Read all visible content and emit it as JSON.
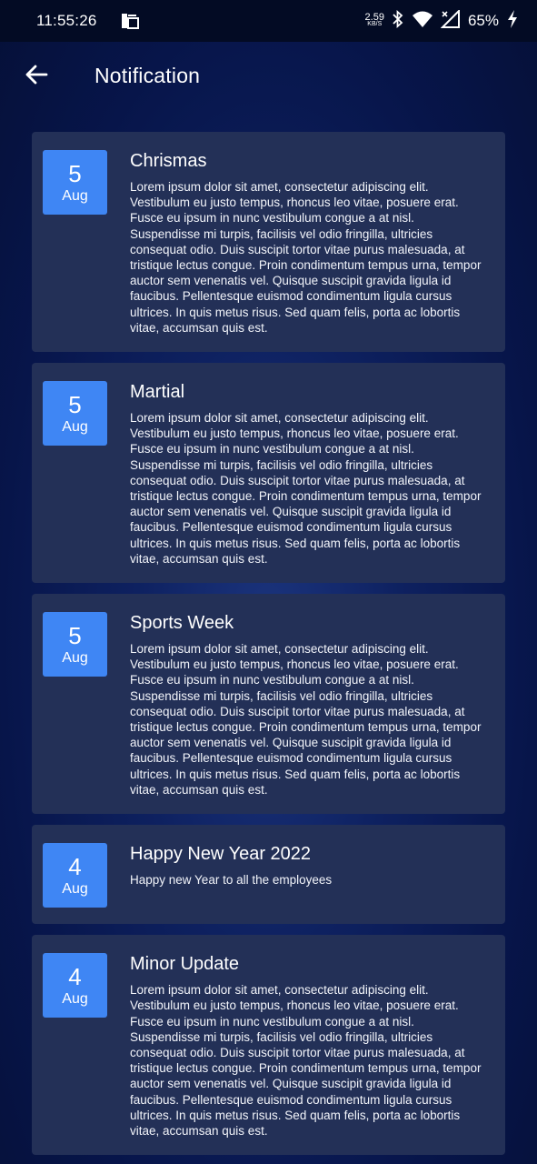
{
  "status_bar": {
    "time": "11:55:26",
    "net_speed_value": "2.59",
    "net_speed_unit": "KB/S",
    "battery": "65%",
    "icons": [
      "notification-app-icon",
      "bluetooth-icon",
      "wifi-icon",
      "signal-icon",
      "battery-charging-icon"
    ]
  },
  "header": {
    "title": "Notification",
    "back_icon": "arrow-left-icon"
  },
  "notifications": [
    {
      "day": "5",
      "month": "Aug",
      "title": "Chrismas",
      "body": "Lorem ipsum dolor sit amet, consectetur adipiscing elit. Vestibulum eu justo tempus, rhoncus leo vitae, posuere erat. Fusce eu ipsum in nunc vestibulum congue a at nisl. Suspendisse mi turpis, facilisis vel odio fringilla, ultricies consequat odio. Duis suscipit tortor vitae purus malesuada, at tristique lectus congue. Proin condimentum tempus urna, tempor auctor sem venenatis vel. Quisque suscipit gravida ligula id faucibus. Pellentesque euismod condimentum ligula cursus ultrices. In quis metus risus. Sed quam felis, porta ac lobortis vitae, accumsan quis est."
    },
    {
      "day": "5",
      "month": "Aug",
      "title": "Martial",
      "body": "Lorem ipsum dolor sit amet, consectetur adipiscing elit. Vestibulum eu justo tempus, rhoncus leo vitae, posuere erat. Fusce eu ipsum in nunc vestibulum congue a at nisl. Suspendisse mi turpis, facilisis vel odio fringilla, ultricies consequat odio. Duis suscipit tortor vitae purus malesuada, at tristique lectus congue. Proin condimentum tempus urna, tempor auctor sem venenatis vel. Quisque suscipit gravida ligula id faucibus. Pellentesque euismod condimentum ligula cursus ultrices. In quis metus risus. Sed quam felis, porta ac lobortis vitae, accumsan quis est."
    },
    {
      "day": "5",
      "month": "Aug",
      "title": "Sports Week",
      "body": "Lorem ipsum dolor sit amet, consectetur adipiscing elit. Vestibulum eu justo tempus, rhoncus leo vitae, posuere erat. Fusce eu ipsum in nunc vestibulum congue a at nisl. Suspendisse mi turpis, facilisis vel odio fringilla, ultricies consequat odio. Duis suscipit tortor vitae purus malesuada, at tristique lectus congue. Proin condimentum tempus urna, tempor auctor sem venenatis vel. Quisque suscipit gravida ligula id faucibus. Pellentesque euismod condimentum ligula cursus ultrices. In quis metus risus. Sed quam felis, porta ac lobortis vitae, accumsan quis est."
    },
    {
      "day": "4",
      "month": "Aug",
      "title": "Happy New Year 2022",
      "body": "Happy new Year to all the employees"
    },
    {
      "day": "4",
      "month": "Aug",
      "title": "Minor Update",
      "body": "Lorem ipsum dolor sit amet, consectetur adipiscing elit. Vestibulum eu justo tempus, rhoncus leo vitae, posuere erat. Fusce eu ipsum in nunc vestibulum congue a at nisl. Suspendisse mi turpis, facilisis vel odio fringilla, ultricies consequat odio. Duis suscipit tortor vitae purus malesuada, at tristique lectus congue. Proin condimentum tempus urna, tempor auctor sem venenatis vel. Quisque suscipit gravida ligula id faucibus. Pellentesque euismod condimentum ligula cursus ultrices. In quis metus risus. Sed quam felis, porta ac lobortis vitae, accumsan quis est."
    }
  ],
  "colors": {
    "background": "#07154a",
    "card": "#233057",
    "date_badge": "#3f86f4",
    "status_bar": "#030b24"
  }
}
